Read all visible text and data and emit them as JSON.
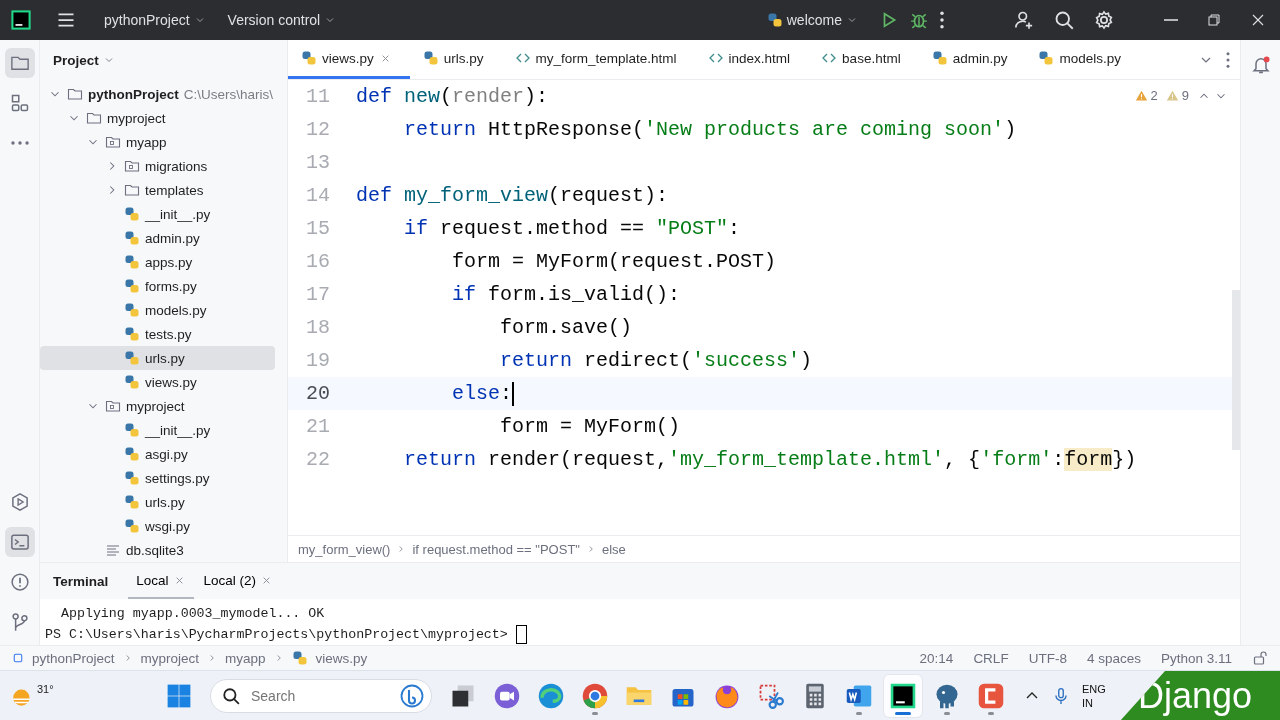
{
  "title_bar": {
    "project": "pythonProject",
    "vcs": "Version control",
    "run_config": "welcome"
  },
  "project_panel": {
    "title": "Project",
    "tree": [
      {
        "label": "pythonProject",
        "hint": "C:\\Users\\haris\\",
        "kind": "folder",
        "expanded": true,
        "selected": false,
        "children": [
          {
            "label": "myproject",
            "kind": "folder",
            "expanded": true,
            "selected": false,
            "children": [
              {
                "label": "myapp",
                "kind": "package",
                "expanded": true,
                "selected": false,
                "children": [
                  {
                    "label": "migrations",
                    "kind": "package",
                    "expanded": false,
                    "selected": false
                  },
                  {
                    "label": "templates",
                    "kind": "folder",
                    "expanded": false,
                    "selected": false
                  },
                  {
                    "label": "__init__.py",
                    "kind": "python",
                    "selected": false
                  },
                  {
                    "label": "admin.py",
                    "kind": "python",
                    "selected": false
                  },
                  {
                    "label": "apps.py",
                    "kind": "python",
                    "selected": false
                  },
                  {
                    "label": "forms.py",
                    "kind": "python",
                    "selected": false
                  },
                  {
                    "label": "models.py",
                    "kind": "python",
                    "selected": false
                  },
                  {
                    "label": "tests.py",
                    "kind": "python",
                    "selected": false
                  },
                  {
                    "label": "urls.py",
                    "kind": "python",
                    "selected": true
                  },
                  {
                    "label": "views.py",
                    "kind": "python",
                    "selected": false
                  }
                ]
              },
              {
                "label": "myproject",
                "kind": "package",
                "expanded": true,
                "selected": false,
                "children": [
                  {
                    "label": "__init__.py",
                    "kind": "python",
                    "selected": false
                  },
                  {
                    "label": "asgi.py",
                    "kind": "python",
                    "selected": false
                  },
                  {
                    "label": "settings.py",
                    "kind": "python",
                    "selected": false
                  },
                  {
                    "label": "urls.py",
                    "kind": "python",
                    "selected": false
                  },
                  {
                    "label": "wsgi.py",
                    "kind": "python",
                    "selected": false
                  }
                ]
              },
              {
                "label": "db.sqlite3",
                "kind": "db",
                "selected": false
              }
            ]
          }
        ]
      }
    ]
  },
  "editor": {
    "tabs": [
      {
        "label": "views.py",
        "kind": "python",
        "selected": true
      },
      {
        "label": "urls.py",
        "kind": "python",
        "selected": false
      },
      {
        "label": "my_form_template.html",
        "kind": "html",
        "selected": false
      },
      {
        "label": "index.html",
        "kind": "html",
        "selected": false
      },
      {
        "label": "base.html",
        "kind": "html",
        "selected": false
      },
      {
        "label": "admin.py",
        "kind": "python",
        "selected": false
      },
      {
        "label": "models.py",
        "kind": "python",
        "selected": false
      }
    ],
    "inspections": {
      "warnings": "2",
      "weak_warnings": "9"
    },
    "lines": [
      {
        "number": "11",
        "current": false,
        "tokens": [
          {
            "kind": "keyword",
            "text": "def "
          },
          {
            "kind": "function",
            "text": "new"
          },
          {
            "kind": "plain",
            "text": "("
          },
          {
            "kind": "unused",
            "text": "render"
          },
          {
            "kind": "plain",
            "text": "):"
          }
        ]
      },
      {
        "number": "12",
        "current": false,
        "tokens": [
          {
            "kind": "keyword",
            "text": "    return"
          },
          {
            "kind": "plain",
            "text": " HttpResponse("
          },
          {
            "kind": "string",
            "text": "'New products are coming soon'"
          },
          {
            "kind": "plain",
            "text": ")"
          }
        ]
      },
      {
        "number": "13",
        "current": false
      },
      {
        "number": "14",
        "current": false,
        "tokens": [
          {
            "kind": "keyword",
            "text": "def "
          },
          {
            "kind": "function",
            "text": "my_form_view"
          },
          {
            "kind": "plain",
            "text": "(request):"
          }
        ]
      },
      {
        "number": "15",
        "current": false,
        "tokens": [
          {
            "kind": "keyword",
            "text": "    if"
          },
          {
            "kind": "plain",
            "text": " request.method == "
          },
          {
            "kind": "string",
            "text": "\"POST\""
          },
          {
            "kind": "plain",
            "text": ":"
          }
        ]
      },
      {
        "number": "16",
        "current": false,
        "tokens": [
          {
            "kind": "plain",
            "text": "        form = MyForm(request.POST)"
          }
        ]
      },
      {
        "number": "17",
        "current": false,
        "tokens": [
          {
            "kind": "keyword",
            "text": "        if"
          },
          {
            "kind": "plain",
            "text": " form.is_valid():"
          }
        ]
      },
      {
        "number": "18",
        "current": false,
        "tokens": [
          {
            "kind": "plain",
            "text": "            form.save()"
          }
        ]
      },
      {
        "number": "19",
        "current": false,
        "tokens": [
          {
            "kind": "keyword",
            "text": "            return"
          },
          {
            "kind": "plain",
            "text": " redirect("
          },
          {
            "kind": "string",
            "text": "'success'"
          },
          {
            "kind": "plain",
            "text": ")"
          }
        ]
      },
      {
        "number": "20",
        "current": true,
        "tokens": [
          {
            "kind": "keyword",
            "text": "        else"
          },
          {
            "kind": "plain",
            "text": ":"
          }
        ]
      },
      {
        "number": "21",
        "current": false,
        "tokens": [
          {
            "kind": "plain",
            "text": "            form = MyForm()"
          }
        ]
      },
      {
        "number": "22",
        "current": false,
        "tokens": [
          {
            "kind": "keyword",
            "text": "    return"
          },
          {
            "kind": "plain",
            "text": " render(request,"
          },
          {
            "kind": "string",
            "text": "'my_form_template.html'"
          },
          {
            "kind": "plain",
            "text": ", {"
          },
          {
            "kind": "string",
            "text": "'form'"
          },
          {
            "kind": "plain",
            "text": ":"
          },
          {
            "kind": "usage",
            "text": "form"
          },
          {
            "kind": "plain",
            "text": "})"
          }
        ]
      }
    ],
    "breadcrumbs": [
      "my_form_view()",
      "if request.method == \"POST\"",
      "else"
    ]
  },
  "terminal": {
    "title": "Terminal",
    "tabs": [
      {
        "label": "Local",
        "selected": true
      },
      {
        "label": "Local (2)",
        "selected": false
      }
    ],
    "output": "  Applying myapp.0003_mymodel... OK",
    "prompt": "PS C:\\Users\\haris\\PycharmProjects\\pythonProject\\myproject>"
  },
  "status_bar": {
    "path": [
      {
        "label": "pythonProject",
        "kind": "module"
      },
      {
        "label": "myproject",
        "kind": "plain"
      },
      {
        "label": "myapp",
        "kind": "plain"
      },
      {
        "label": "views.py",
        "kind": "python"
      }
    ],
    "items": [
      "20:14",
      "CRLF",
      "UTF-8",
      "4 spaces",
      "Python 3.11"
    ]
  },
  "taskbar": {
    "weather": "31°",
    "search": {
      "placeholder": "Search"
    },
    "apps": [
      {
        "kind": "taskview",
        "running": false,
        "selected": false
      },
      {
        "kind": "meet",
        "running": false,
        "selected": false
      },
      {
        "kind": "edge",
        "running": false,
        "selected": false
      },
      {
        "kind": "chrome",
        "running": true,
        "selected": false
      },
      {
        "kind": "explorer",
        "running": false,
        "selected": false
      },
      {
        "kind": "store",
        "running": false,
        "selected": false
      },
      {
        "kind": "firefox",
        "running": false,
        "selected": false
      },
      {
        "kind": "snip",
        "running": false,
        "selected": false
      },
      {
        "kind": "calculator",
        "running": false,
        "selected": false
      },
      {
        "kind": "word",
        "running": true,
        "selected": false
      },
      {
        "kind": "pycharm",
        "running": true,
        "selected": true
      },
      {
        "kind": "postgres",
        "running": true,
        "selected": false
      },
      {
        "kind": "camtasia",
        "running": true,
        "selected": false
      }
    ],
    "language": [
      "ENG",
      "IN"
    ]
  },
  "overlay_label": "Django"
}
